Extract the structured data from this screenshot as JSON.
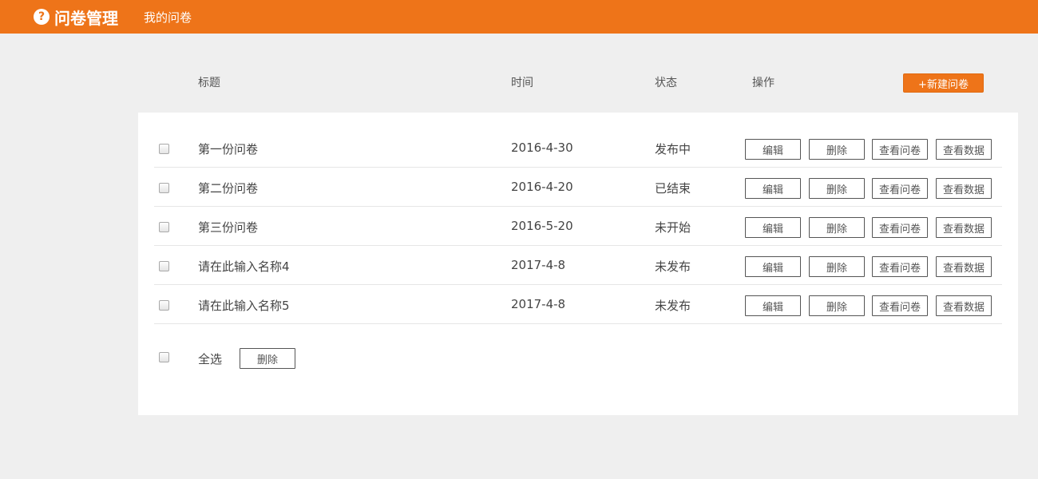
{
  "header": {
    "brand_icon": "question-circle-icon",
    "brand": "问卷管理",
    "nav": "我的问卷",
    "accent_color": "#ee7419"
  },
  "table": {
    "columns": [
      "标题",
      "时间",
      "状态",
      "操作"
    ],
    "new_button": "+新建问卷",
    "rows": [
      {
        "title": "第一份问卷",
        "date": "2016-4-30",
        "status": "发布中"
      },
      {
        "title": "第二份问卷",
        "date": "2016-4-20",
        "status": "已结束"
      },
      {
        "title": "第三份问卷",
        "date": "2016-5-20",
        "status": "未开始"
      },
      {
        "title": "请在此输入名称4",
        "date": "2017-4-8",
        "status": "未发布"
      },
      {
        "title": "请在此输入名称5",
        "date": "2017-4-8",
        "status": "未发布"
      }
    ],
    "actions": {
      "edit": "编辑",
      "delete": "删除",
      "view_survey": "查看问卷",
      "view_data": "查看数据"
    },
    "footer": {
      "select_all": "全选",
      "delete": "删除"
    }
  }
}
